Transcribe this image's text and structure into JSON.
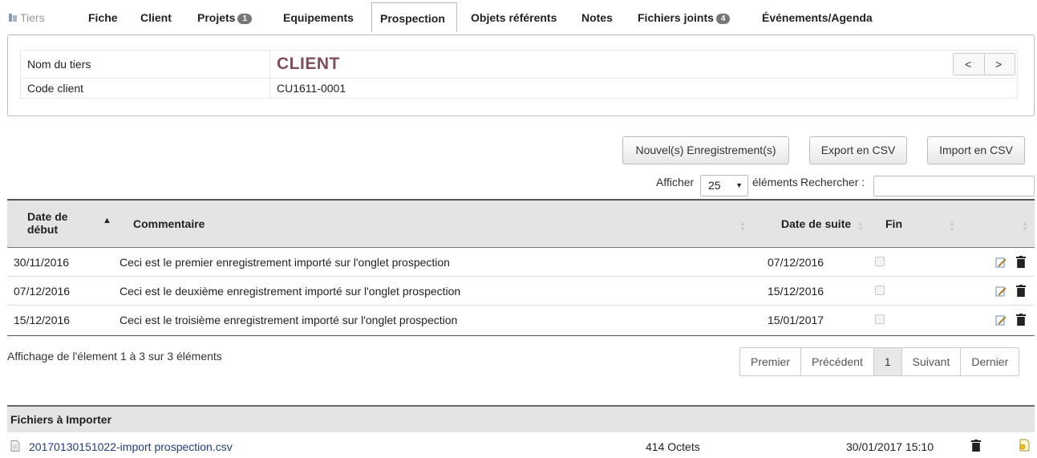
{
  "tabs": [
    {
      "label": "Tiers",
      "badge": null
    },
    {
      "label": "Fiche",
      "badge": null
    },
    {
      "label": "Client",
      "badge": null
    },
    {
      "label": "Projets",
      "badge": "1"
    },
    {
      "label": "Equipements",
      "badge": null
    },
    {
      "label": "Prospection",
      "badge": null,
      "active": true
    },
    {
      "label": "Objets référents",
      "badge": null
    },
    {
      "label": "Notes",
      "badge": null
    },
    {
      "label": "Fichiers joints",
      "badge": "4"
    },
    {
      "label": "Événements/Agenda",
      "badge": null
    }
  ],
  "thirdparty": {
    "name_label": "Nom du tiers",
    "name_value": "CLIENT",
    "code_label": "Code client",
    "code_value": "CU1611-0001",
    "prev": "<",
    "next": ">"
  },
  "actions": {
    "new": "Nouvel(s) Enregistrement(s)",
    "export": "Export en CSV",
    "import": "Import en CSV"
  },
  "length": {
    "show": "Afficher",
    "value": "25",
    "elements": "éléments",
    "search": "Rechercher :"
  },
  "table": {
    "headers": {
      "date_start_1": "Date de",
      "date_start_2": "début",
      "comment": "Commentaire",
      "date_next": "Date de suite",
      "end": "Fin"
    },
    "rows": [
      {
        "start": "30/11/2016",
        "comment": "Ceci est le premier enregistrement importé sur l'onglet prospection",
        "next": "07/12/2016"
      },
      {
        "start": "07/12/2016",
        "comment": "Ceci est le deuxième enregistrement importé sur l'onglet prospection",
        "next": "15/12/2016"
      },
      {
        "start": "15/12/2016",
        "comment": "Ceci est le troisième enregistrement importé sur l'onglet prospection",
        "next": "15/01/2017"
      }
    ]
  },
  "footer": {
    "info": "Affichage de l'élement 1 à 3 sur 3 éléments",
    "pager": {
      "first": "Premier",
      "prev": "Précédent",
      "current": "1",
      "next": "Suivant",
      "last": "Dernier"
    }
  },
  "files": {
    "header": "Fichiers à Importer",
    "items": [
      {
        "name": "20170130151022-import prospection.csv",
        "size": "414 Octets",
        "date": "30/01/2017 15:10"
      }
    ]
  },
  "colors": {
    "client_name": "#7d4f5b",
    "link": "#263c7e",
    "header_bg": "#e4e4e4"
  }
}
